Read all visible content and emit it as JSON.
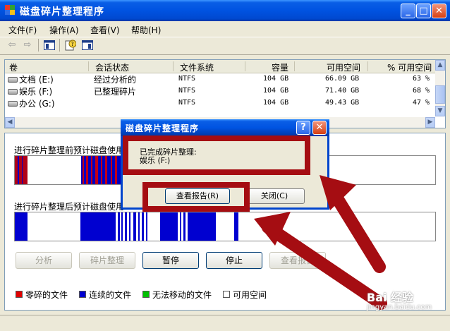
{
  "window": {
    "title": "磁盘碎片整理程序"
  },
  "menu": [
    "文件(F)",
    "操作(A)",
    "查看(V)",
    "帮助(H)"
  ],
  "list": {
    "headers": [
      "卷",
      "会话状态",
      "文件系统",
      "容量",
      "可用空间",
      "% 可用空间"
    ],
    "rows": [
      {
        "volume": "文档 (E:)",
        "status": "经过分析的",
        "fs": "NTFS",
        "capacity": "104 GB",
        "free": "66.09 GB",
        "pct": "63 %"
      },
      {
        "volume": "娱乐 (F:)",
        "status": "已整理碎片",
        "fs": "NTFS",
        "capacity": "104 GB",
        "free": "71.40 GB",
        "pct": "68 %"
      },
      {
        "volume": "办公 (G:)",
        "status": "",
        "fs": "NTFS",
        "capacity": "104 GB",
        "free": "49.43 GB",
        "pct": "47 %"
      }
    ]
  },
  "lower": {
    "before_label": "进行碎片整理前预计磁盘使用",
    "after_label": "进行碎片整理后预计磁盘使用",
    "buttons": {
      "analyze": "分析",
      "defrag": "碎片整理",
      "pause": "暂停",
      "stop": "停止",
      "report": "查看报告"
    },
    "legend": [
      {
        "label": "零碎的文件",
        "color": "#e00000"
      },
      {
        "label": "连续的文件",
        "color": "#0000d0"
      },
      {
        "label": "无法移动的文件",
        "color": "#00c000"
      },
      {
        "label": "可用空间",
        "color": "#ffffff"
      }
    ]
  },
  "dialog": {
    "title": "磁盘碎片整理程序",
    "message_line1": "已完成碎片整理:",
    "message_line2": "娱乐 (F:)",
    "view_report": "查看报告(R)",
    "close": "关闭(C)",
    "help": "?",
    "close_x": "✕"
  },
  "watermark": {
    "text": "Bai 经验",
    "url": "jingyan.baidu.com"
  },
  "colors": {
    "annotation": "#a50d12",
    "fragmented": "#e00000",
    "contiguous": "#0000d0",
    "title_blue": "#0053e1"
  }
}
